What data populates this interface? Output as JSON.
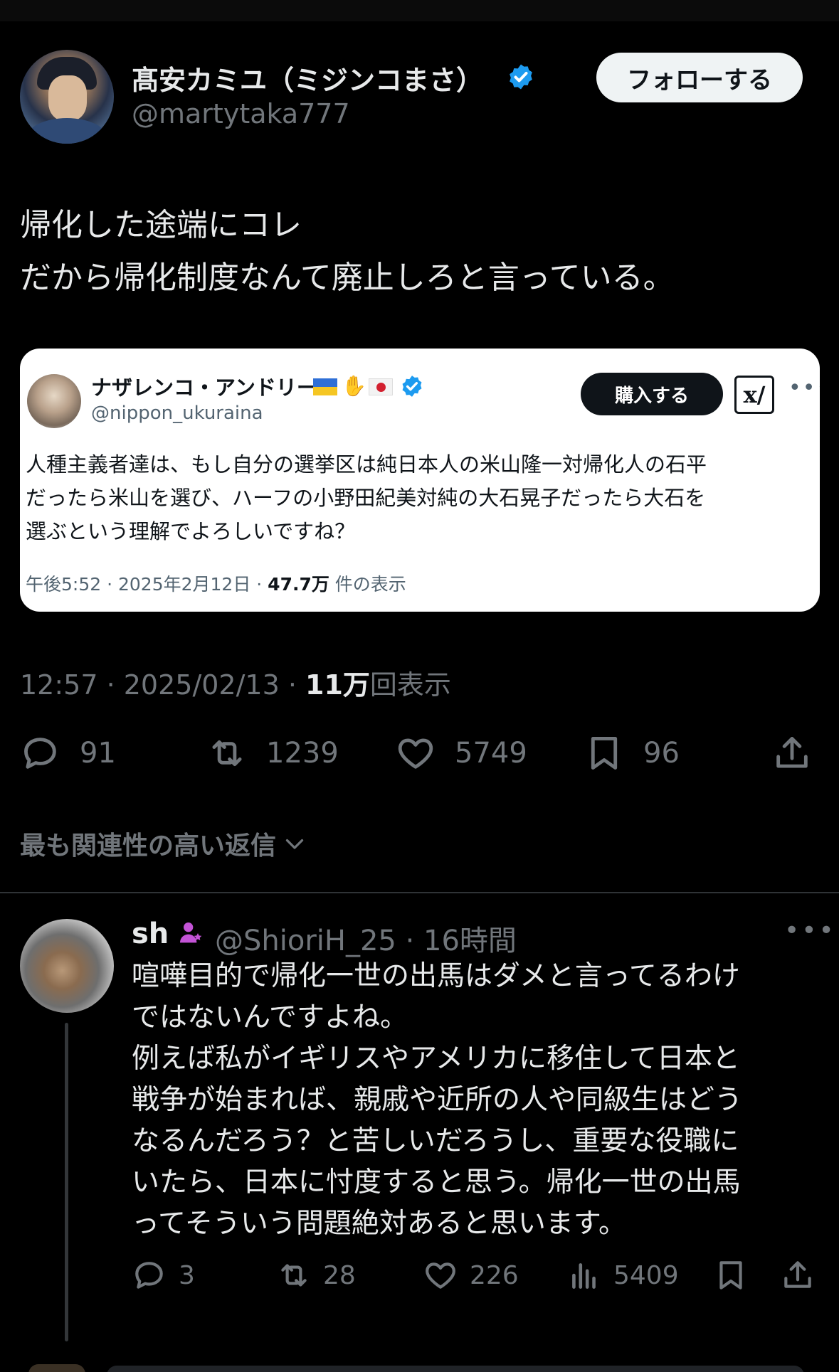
{
  "colors": {
    "background": "#000000",
    "text": "#e7e9ea",
    "muted": "#71767b",
    "verified": "#1d9bf0",
    "card_bg": "#ffffff"
  },
  "main_tweet": {
    "display_name": "髙安カミユ（ミジンコまさ）",
    "handle": "@martytaka777",
    "follow_label": "フォローする",
    "text_lines": [
      "帰化した途端にコレ",
      "だから帰化制度なんて廃止しろと言っている。"
    ],
    "timestamp": "12:57 · 2025/02/13 · ",
    "views_count": "11万",
    "views_label": "回表示",
    "stats": {
      "replies": "91",
      "retweets": "1239",
      "likes": "5749",
      "bookmarks": "96"
    }
  },
  "embedded_card": {
    "display_name": "ナザレンコ・アンドリー",
    "handle": "@nippon_ukuraina",
    "buy_label": "購入する",
    "xai_label": "x/",
    "text_lines": [
      "人種主義者達は、もし自分の選挙区は純日本人の米山隆一対帰化人の石平",
      "だったら米山を選び、ハーフの小野田紀美対純の大石晃子だったら大石を",
      "選ぶという理解でよろしいですね？"
    ],
    "meta_prefix": "午後5:52 · 2025年2月12日 · ",
    "views_count": "47.7万",
    "views_label": " 件の表示"
  },
  "replies_sort_label": "最も関連性の高い返信",
  "reply": {
    "display_name": "sh",
    "handle_time": "@ShioriH_25 · 16時間",
    "text_lines": [
      "喧嘩目的で帰化一世の出馬はダメと言ってるわけ",
      "ではないんですよね。",
      "例えば私がイギリスやアメリカに移住して日本と",
      "戦争が始まれば、親戚や近所の人や同級生はどう",
      "なるんだろう？と苦しいだろうし、重要な役職に",
      "いたら、日本に忖度すると思う。帰化一世の出馬",
      "ってそういう問題絶対あると思います。"
    ],
    "stats": {
      "replies": "3",
      "retweets": "28",
      "likes": "226",
      "views": "5409"
    }
  },
  "icons": [
    "verified-icon",
    "reply-icon",
    "retweet-icon",
    "like-icon",
    "bookmark-icon",
    "share-icon",
    "views-icon",
    "chevron-down-icon",
    "more-icon",
    "badge-icon"
  ]
}
